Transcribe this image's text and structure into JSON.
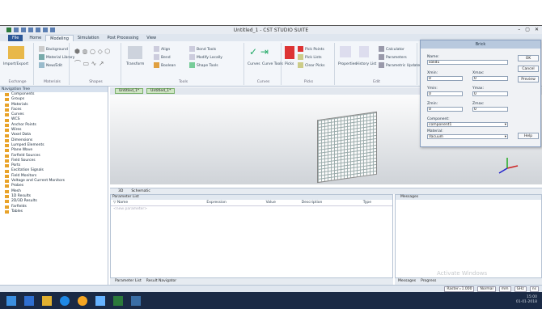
{
  "window": {
    "title": "Untitled_1 - CST STUDIO SUITE",
    "controls": [
      "–",
      "▢",
      "✕"
    ]
  },
  "ribbon": {
    "tabs": [
      "File",
      "Home",
      "Modeling",
      "Simulation",
      "Post Processing",
      "View"
    ],
    "active_tab": "Modeling",
    "groups": [
      {
        "label": "Exchange",
        "items": [
          "Import/Export"
        ]
      },
      {
        "label": "Materials",
        "items": [
          "Background",
          "Material Library",
          "New/Edit"
        ]
      },
      {
        "label": "Shapes",
        "items": []
      },
      {
        "label": "Tools",
        "items": [
          "Align",
          "Bend",
          "Boolean",
          "Bond Tools",
          "Modify Locally",
          "Shape Tools",
          "Transform"
        ]
      },
      {
        "label": "Curves",
        "items": [
          "Curves",
          "Curve Tools"
        ]
      },
      {
        "label": "Picks",
        "items": [
          "Picks",
          "Pick Points",
          "Pick Lists",
          "Clear Picks"
        ]
      },
      {
        "label": "Edit",
        "items": [
          "Properties",
          "History List",
          "Calculator",
          "Parameters",
          "Parametric Update"
        ]
      }
    ]
  },
  "navigation_tree": {
    "header": "Navigation Tree",
    "items": [
      "Components",
      "Groups",
      "Materials",
      "Faces",
      "Curves",
      "WCS",
      "Anchor Points",
      "Wires",
      "Voxel Data",
      "Dimensions",
      "Lumped Elements",
      "Plane Wave",
      "Farfield Sources",
      "Field Sources",
      "Ports",
      "Excitation Signals",
      "Field Monitors",
      "Voltage and Current Monitors",
      "Probes",
      "Mesh",
      "1D Results",
      "2D/3D Results",
      "Farfields",
      "Tables"
    ]
  },
  "viewport": {
    "tabs": [
      "Untitled_1*",
      "Untitled_1*"
    ]
  },
  "bottom_tabs": [
    "3D",
    "Schematic"
  ],
  "parameter_list": {
    "header": "Parameter List",
    "columns": [
      "Name",
      "Expression",
      "Value",
      "Description",
      "Type"
    ],
    "placeholder_row": "<new parameter>"
  },
  "parameter_tabs": [
    "Parameter List",
    "Result Navigator"
  ],
  "messages": {
    "header": "Messages",
    "tabs": [
      "Messages",
      "Progress"
    ]
  },
  "watermark": "Activate Windows",
  "statusbar": {
    "items": [
      "Raster=1.000",
      "Normal",
      "mm",
      "GHz",
      "ns"
    ]
  },
  "tray": {
    "time": "15:00",
    "date": "01-01-2018"
  },
  "dialog": {
    "title": "Brick",
    "name_label": "Name:",
    "name_value": "solid1",
    "xmin_label": "Xmin:",
    "xmin_value": "0",
    "xmax_label": "Xmax:",
    "xmax_value": "0",
    "ymin_label": "Ymin:",
    "ymin_value": "0",
    "ymax_label": "Ymax:",
    "ymax_value": "0",
    "zmin_label": "Zmin:",
    "zmin_value": "0",
    "zmax_label": "Zmax:",
    "zmax_value": "0",
    "component_label": "Component:",
    "component_value": "component1",
    "material_label": "Material:",
    "material_value": "Vacuum",
    "buttons": [
      "OK",
      "Cancel",
      "Preview",
      "Help"
    ]
  }
}
